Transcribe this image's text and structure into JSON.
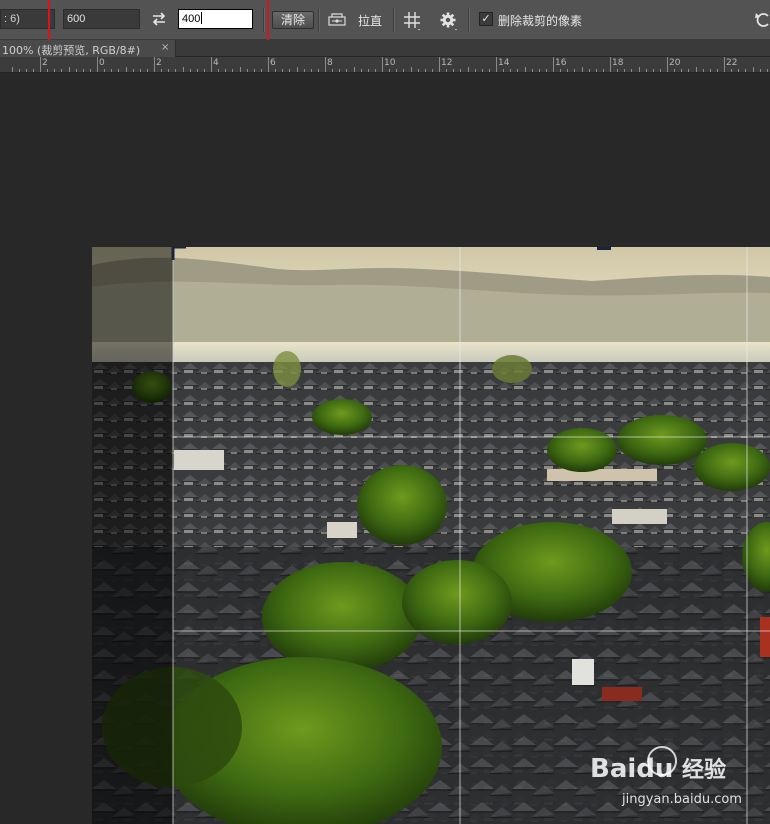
{
  "options_bar": {
    "ratio_value": ": 6)",
    "width_value": "600",
    "height_value": "400",
    "clear_label": "清除",
    "straighten_label": "拉直",
    "delete_pixels_checked": "✓",
    "delete_pixels_label": "删除裁剪的像素"
  },
  "document": {
    "tab_title": "100% (裁剪预览, RGB/8#)",
    "close_glyph": "×"
  },
  "ruler": {
    "labels": [
      "2",
      "0",
      "2",
      "4",
      "6",
      "8",
      "10",
      "12",
      "14",
      "16",
      "18",
      "20",
      "22"
    ]
  },
  "watermark": {
    "brand": "Baidu",
    "brand_cn": "经验",
    "url": "jingyan.baidu.com"
  },
  "colors": {
    "options_bg": "#535353",
    "canvas_bg": "#282828",
    "highlight": "#d9141c"
  }
}
